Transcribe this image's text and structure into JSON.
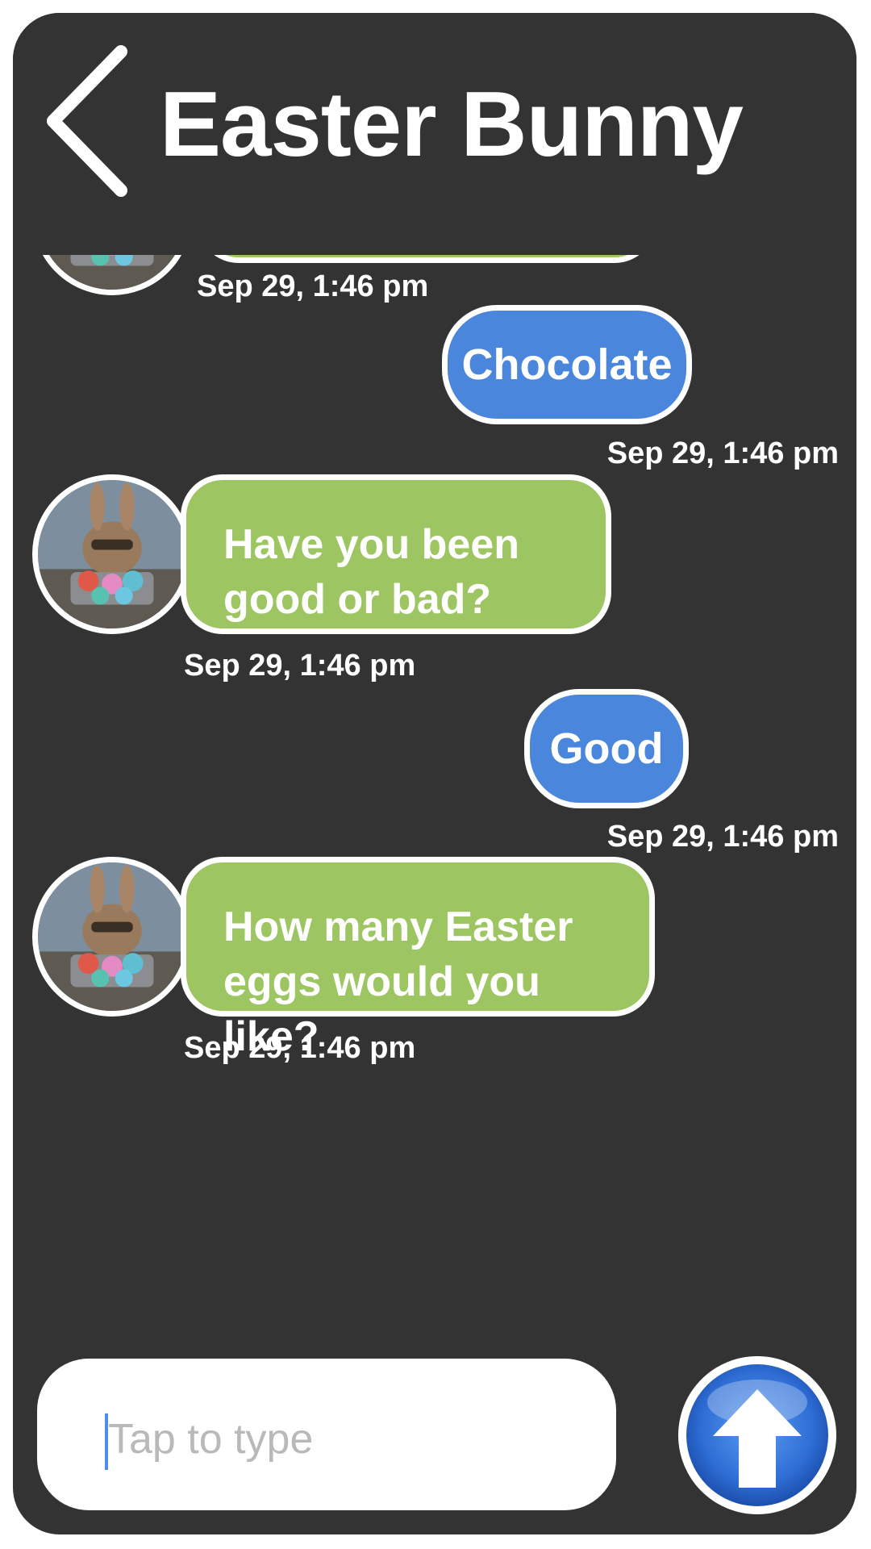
{
  "header": {
    "title": "Easter Bunny",
    "back_icon": "chevron-left-icon"
  },
  "messages": [
    {
      "from": "bot",
      "text": "",
      "time": "Sep 29, 1:46 pm"
    },
    {
      "from": "user",
      "text": "Chocolate",
      "time": "Sep 29, 1:46 pm"
    },
    {
      "from": "bot",
      "text": "Have you been good or bad?",
      "time": "Sep 29, 1:46 pm"
    },
    {
      "from": "user",
      "text": "Good",
      "time": "Sep 29, 1:46 pm"
    },
    {
      "from": "bot",
      "text": "How many Easter eggs would you like?",
      "time": "Sep 29, 1:46 pm"
    }
  ],
  "composer": {
    "placeholder": "Tap to type",
    "send_icon": "arrow-up-icon"
  },
  "colors": {
    "background": "#333333",
    "bot_bubble": "#9dc562",
    "user_bubble": "#4a86dc",
    "send_button": "#2f6fd6"
  }
}
